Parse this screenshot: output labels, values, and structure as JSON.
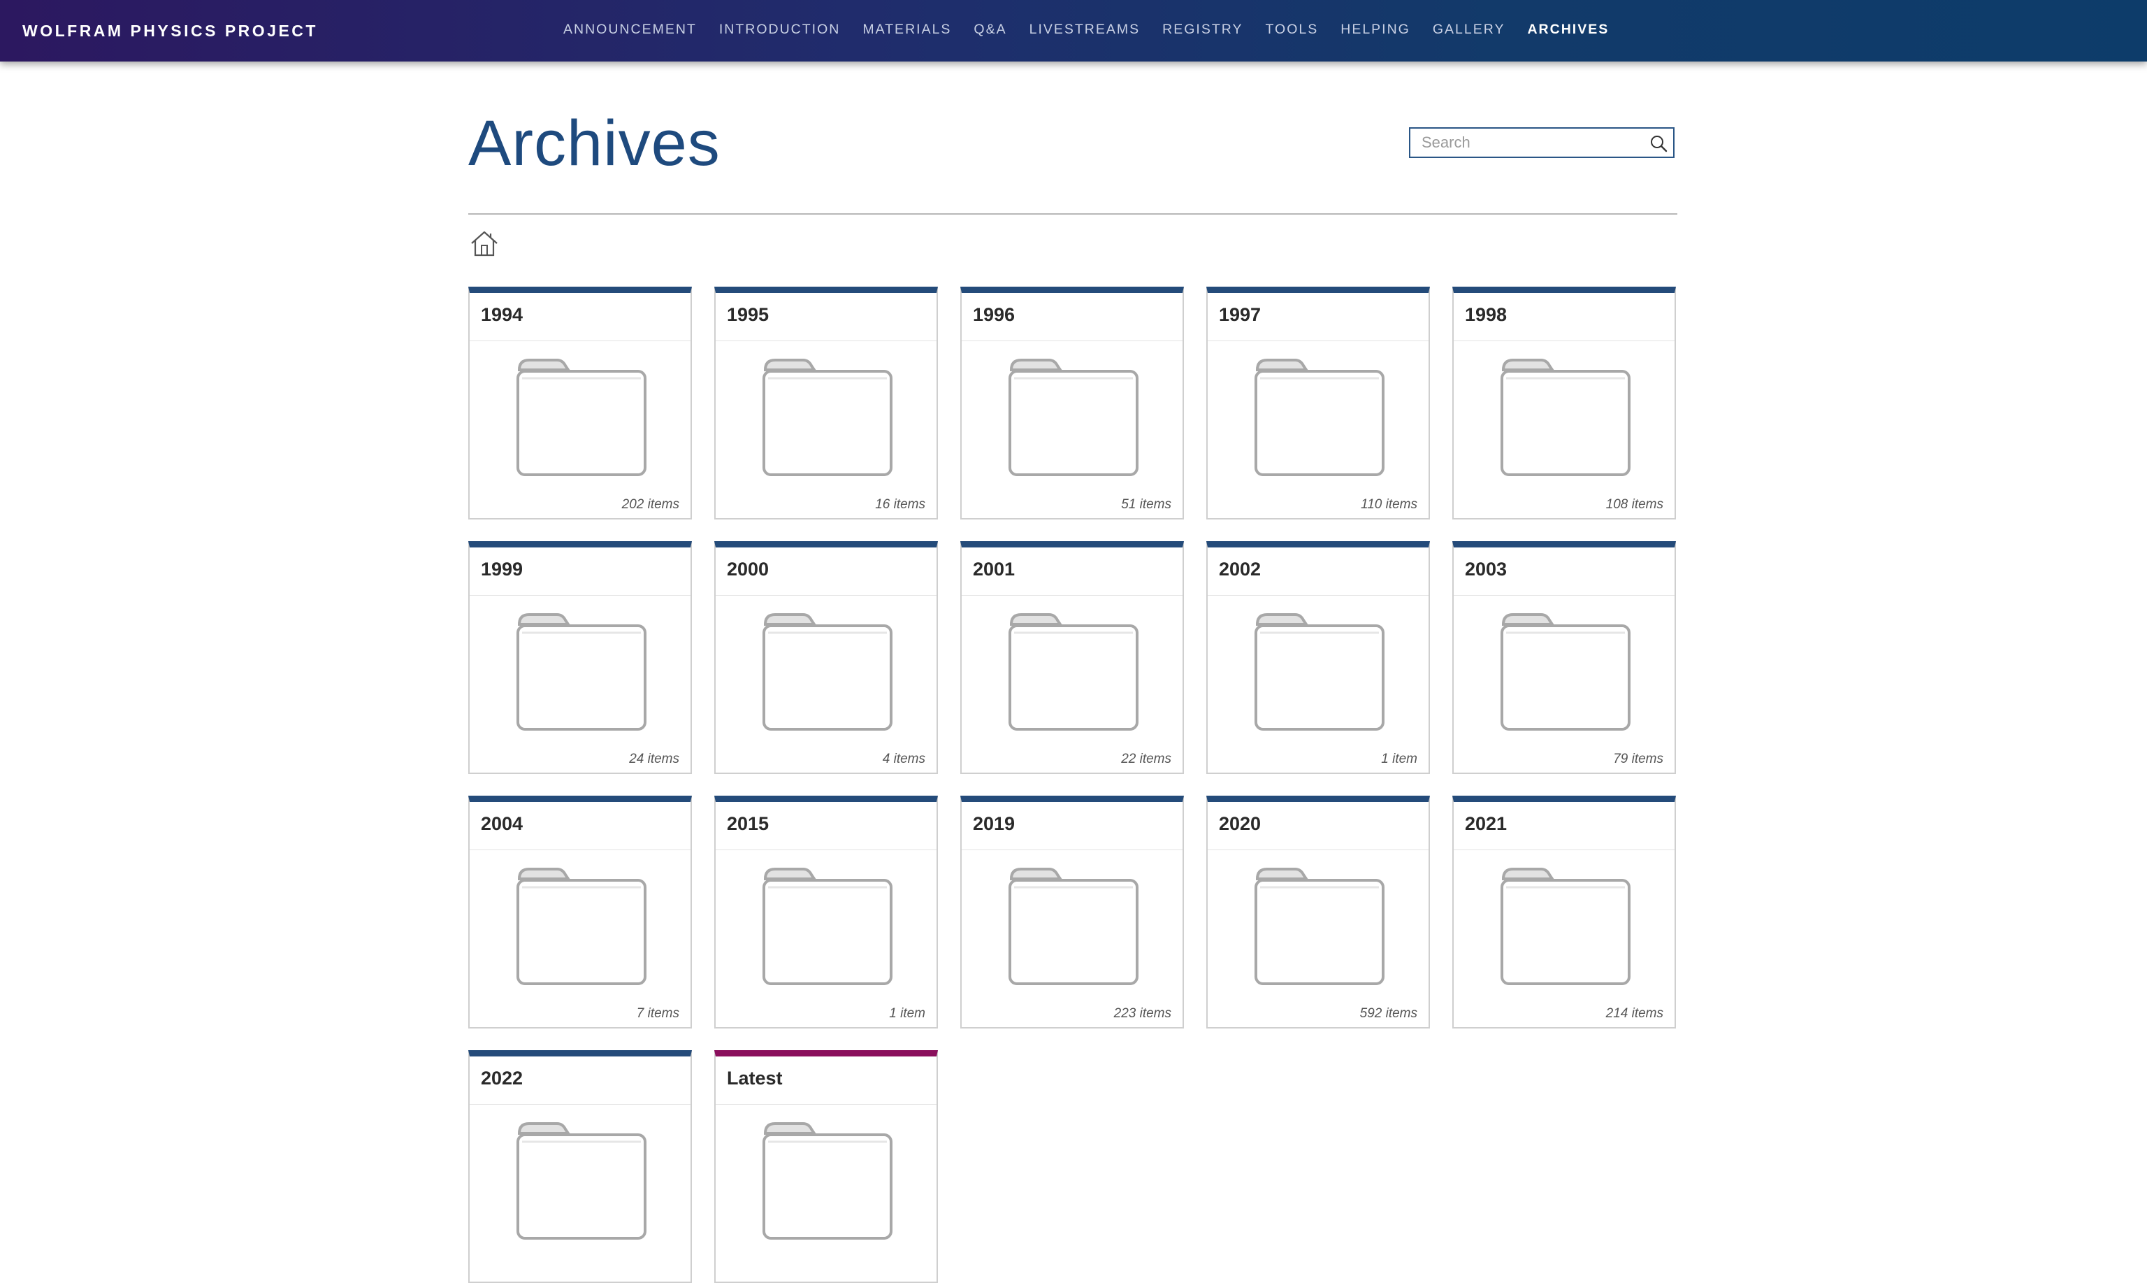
{
  "site": {
    "brand": "WOLFRAM PHYSICS PROJECT"
  },
  "nav": {
    "items": [
      {
        "label": "ANNOUNCEMENT",
        "active": false
      },
      {
        "label": "INTRODUCTION",
        "active": false
      },
      {
        "label": "MATERIALS",
        "active": false
      },
      {
        "label": "Q&A",
        "active": false
      },
      {
        "label": "LIVESTREAMS",
        "active": false
      },
      {
        "label": "REGISTRY",
        "active": false
      },
      {
        "label": "TOOLS",
        "active": false
      },
      {
        "label": "HELPING",
        "active": false
      },
      {
        "label": "GALLERY",
        "active": false
      },
      {
        "label": "ARCHIVES",
        "active": true
      }
    ]
  },
  "page": {
    "title": "Archives"
  },
  "search": {
    "placeholder": "Search",
    "value": ""
  },
  "breadcrumb": {
    "home_icon": "home-icon"
  },
  "colors": {
    "card_accent": "#244b7a",
    "latest_accent": "#8a0f5c",
    "title": "#1e4a7e"
  },
  "folders": [
    {
      "title": "1994",
      "count": "202 items"
    },
    {
      "title": "1995",
      "count": "16 items"
    },
    {
      "title": "1996",
      "count": "51 items"
    },
    {
      "title": "1997",
      "count": "110 items"
    },
    {
      "title": "1998",
      "count": "108 items"
    },
    {
      "title": "1999",
      "count": "24 items"
    },
    {
      "title": "2000",
      "count": "4 items"
    },
    {
      "title": "2001",
      "count": "22 items"
    },
    {
      "title": "2002",
      "count": "1 item"
    },
    {
      "title": "2003",
      "count": "79 items"
    },
    {
      "title": "2004",
      "count": "7 items"
    },
    {
      "title": "2015",
      "count": "1 item"
    },
    {
      "title": "2019",
      "count": "223 items"
    },
    {
      "title": "2020",
      "count": "592 items"
    },
    {
      "title": "2021",
      "count": "214 items"
    },
    {
      "title": "2022",
      "count": ""
    },
    {
      "title": "Latest",
      "count": "",
      "latest": true
    }
  ]
}
